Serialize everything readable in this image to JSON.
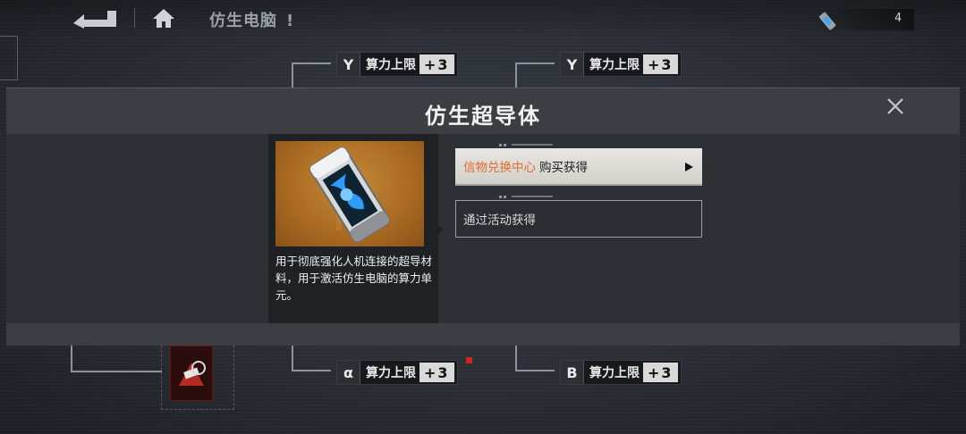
{
  "header": {
    "page_title": "仿生电脑",
    "page_title_mark": "!",
    "currency_count": "4"
  },
  "tree": {
    "nodes": [
      {
        "icon": "Y",
        "label": "算力上限",
        "plus": "+3"
      },
      {
        "icon": "Y",
        "label": "算力上限",
        "plus": "+3"
      },
      {
        "icon": "α",
        "label": "算力上限",
        "plus": "+3"
      },
      {
        "icon": "B",
        "label": "算力上限",
        "plus": "+3"
      }
    ]
  },
  "modal": {
    "title": "仿生超导体",
    "item_description": "用于彻底强化人机连接的超导材料，用于激活仿生电脑的算力单元。",
    "sources": [
      {
        "highlight": "信物兑换中心",
        "text": "购买获得"
      },
      {
        "text": "通过活动获得"
      }
    ]
  },
  "colors": {
    "accent_orange": "#e26a2c",
    "modal_header_bg": "#3b3f44",
    "modal_body_bg": "#2d3034",
    "item_bg": "#b0742a",
    "highlight_red": "#d2251e"
  }
}
